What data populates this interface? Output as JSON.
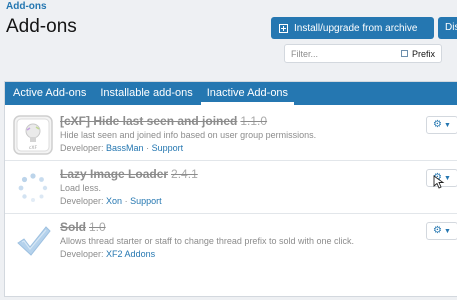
{
  "header": {
    "breadcrumb": "Add-ons",
    "title": "Add-ons",
    "install_label": "Install/upgrade from archive",
    "disable_label": "Disable all"
  },
  "filter": {
    "placeholder": "Filter...",
    "prefix_label": "Prefix"
  },
  "tabs": [
    {
      "label": "Active Add-ons",
      "active": false
    },
    {
      "label": "Installable add-ons",
      "active": false
    },
    {
      "label": "Inactive Add-ons",
      "active": true
    }
  ],
  "addons": [
    {
      "title": "[cXF] Hide last seen and joined",
      "version": "1.1.0",
      "description": "Hide last seen and joined info based on user group permissions.",
      "developer_prefix": "Developer:",
      "developer": "BassMan",
      "support": "Support",
      "icon": "cxf-lightbulb-icon"
    },
    {
      "title": "Lazy Image Loader",
      "version": "2.4.1",
      "description": "Load less.",
      "developer_prefix": "Developer:",
      "developer": "Xon",
      "support": "Support",
      "icon": "loading-spinner-icon"
    },
    {
      "title": "Sold",
      "version": "1.0",
      "description": "Allows thread starter or staff to change thread prefix to sold with one click.",
      "developer_prefix": "Developer:",
      "developer": "XF2 Addons",
      "support": "",
      "icon": "checkmark-icon"
    }
  ],
  "colors": {
    "accent": "#2577b1",
    "background": "#eef0f3",
    "muted_text": "#8c8c8c"
  }
}
